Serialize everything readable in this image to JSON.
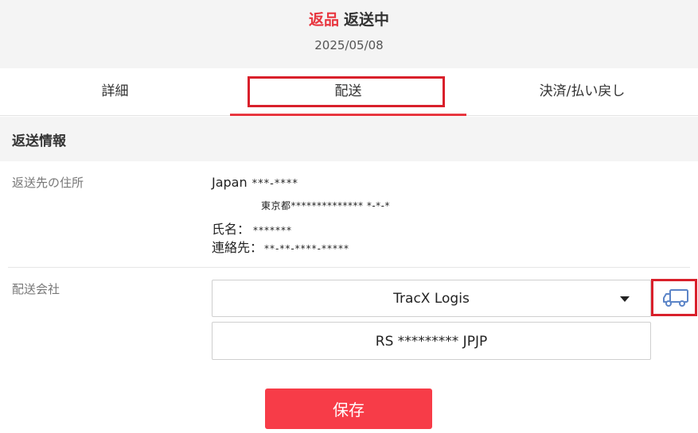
{
  "header": {
    "status_tag": "返品",
    "status_text": "返送中",
    "date": "2025/05/08"
  },
  "tabs": [
    {
      "label": "詳細",
      "active": false
    },
    {
      "label": "配送",
      "active": true
    },
    {
      "label": "決済/払い戻し",
      "active": false
    }
  ],
  "section": {
    "title": "返送情報"
  },
  "address": {
    "label": "返送先の住所",
    "country": "Japan",
    "postal_masked": "***-****",
    "line2": "東京都************** *-*-*",
    "name_label": "氏名：",
    "name_masked": "*******",
    "contact_label": "連絡先：",
    "contact_masked": "**-**-****-*****"
  },
  "carrier": {
    "label": "配送会社",
    "selected": "TracX Logis",
    "icon": "truck-icon",
    "tracking_number": "RS ********* JPJP"
  },
  "actions": {
    "save_label": "保存"
  },
  "colors": {
    "accent": "#f73c48",
    "highlight_border": "#d9202b",
    "truck_icon": "#5b84c7"
  }
}
